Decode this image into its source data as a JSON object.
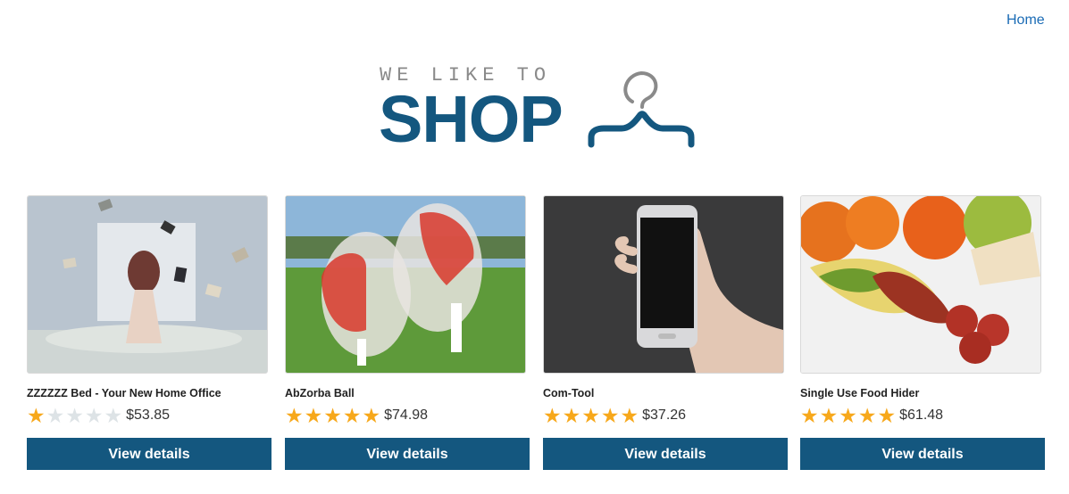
{
  "nav": {
    "home_label": "Home"
  },
  "logo": {
    "small_text": "WE LIKE TO",
    "big_text": "SHOP"
  },
  "colors": {
    "brand": "#14577f",
    "link": "#1a6bb5",
    "star": "#f7a81b",
    "star_empty": "#dde3e6"
  },
  "products": [
    {
      "title": "ZZZZZZ Bed - Your New Home Office",
      "rating": 1,
      "price": "$53.85",
      "button": "View details"
    },
    {
      "title": "AbZorba Ball",
      "rating": 5,
      "price": "$74.98",
      "button": "View details"
    },
    {
      "title": "Com-Tool",
      "rating": 5,
      "price": "$37.26",
      "button": "View details"
    },
    {
      "title": "Single Use Food Hider",
      "rating": 5,
      "price": "$61.48",
      "button": "View details"
    }
  ]
}
